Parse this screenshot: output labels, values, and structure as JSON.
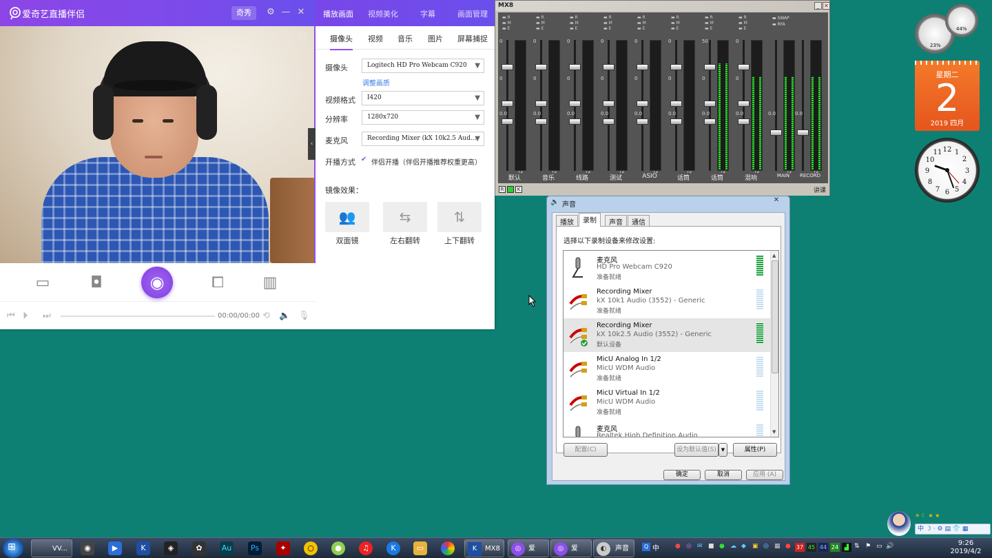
{
  "app": {
    "title": "爱奇艺直播伴侣",
    "qixiu_button": "奇秀",
    "panel_tabs": [
      "播放画面",
      "视频美化",
      "字幕",
      "画面管理"
    ],
    "source_tabs": [
      "摄像头",
      "视频",
      "音乐",
      "图片",
      "屏幕捕捉"
    ],
    "camera_label": "摄像头",
    "camera_value": "Logitech HD Pro Webcam C920",
    "adjust_link": "调整画质",
    "format_label": "视频格式",
    "format_value": "I420",
    "resolution_label": "分辨率",
    "resolution_value": "1280x720",
    "mic_label": "麦克风",
    "mic_value": "Recording Mixer (kX 10k2.5 Aud...",
    "mode_label": "开播方式",
    "mode_value": "伴侣开播（伴侣开播推荐权重更高）",
    "mirror_label": "镜像效果：",
    "mirror_options": [
      "双面镜",
      "左右翻转",
      "上下翻转"
    ],
    "time": "00:00/00:00"
  },
  "mixer": {
    "title": "MX8",
    "channels": [
      {
        "name": "默认",
        "value": "0.0"
      },
      {
        "name": "音乐",
        "value": "0.0"
      },
      {
        "name": "线路",
        "value": "0.0"
      },
      {
        "name": "测试",
        "value": "0.0"
      },
      {
        "name": "ASIO",
        "value": "0.0"
      },
      {
        "name": "话筒",
        "value": "0.0"
      },
      {
        "name": "话筒",
        "value": "0.0"
      },
      {
        "name": "混响",
        "value": "0.0"
      }
    ],
    "main_label": "MAIN",
    "record_label": "RECORD",
    "main_value": "0.0",
    "record_value": "0.0",
    "top_value": "50",
    "scale": [
      "0",
      "12",
      "24",
      "36",
      "48",
      "60",
      "72"
    ],
    "swap": "SWAP",
    "rfa": "RFA",
    "footer_letters": [
      "R",
      "",
      "K"
    ],
    "footer_right": "讲课"
  },
  "sound": {
    "title": "声音",
    "tabs": [
      "播放",
      "录制",
      "声音",
      "通信"
    ],
    "prompt": "选择以下录制设备来修改设置:",
    "devices": [
      {
        "name": "麦克风",
        "desc": "HD Pro Webcam C920",
        "status": "准备就绪"
      },
      {
        "name": "Recording Mixer",
        "desc": "kX 10k1 Audio (3552) - Generic",
        "status": "准备就绪"
      },
      {
        "name": "Recording Mixer",
        "desc": "kX 10k2.5 Audio (3552) - Generic",
        "status": "默认设备"
      },
      {
        "name": "MicU Analog In 1/2",
        "desc": "MicU WDM Audio",
        "status": "准备就绪"
      },
      {
        "name": "MicU Virtual In 1/2",
        "desc": "MicU WDM Audio",
        "status": "准备就绪"
      },
      {
        "name": "麦克风",
        "desc": "Realtek High Definition Audio",
        "status": ""
      }
    ],
    "configure": "配置(C)",
    "set_default": "设为默认值(S)",
    "properties": "属性(P)",
    "ok": "确定",
    "cancel": "取消",
    "apply": "应用 (A)"
  },
  "gadgets": {
    "gauge_left": "23%",
    "gauge_right": "44%",
    "weekday": "星期二",
    "day": "2",
    "month": "2019 四月"
  },
  "taskbar": {
    "items": [
      "VV...",
      "MX8",
      "爱奇...",
      "爱奇...",
      "声音"
    ],
    "tray_numbers": [
      "37",
      "45",
      "44",
      "24"
    ],
    "ime": "中",
    "time": "9:26",
    "date": "2019/4/2"
  }
}
